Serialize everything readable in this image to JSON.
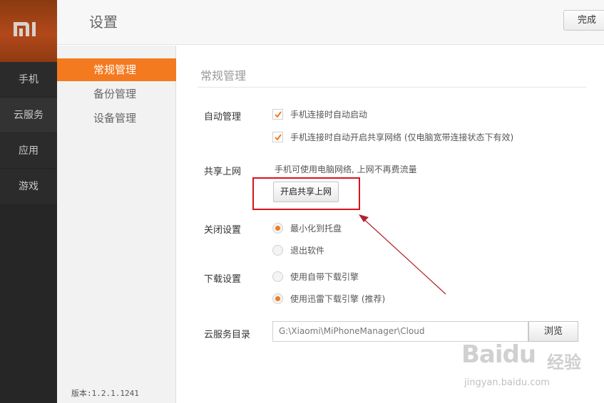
{
  "app": {
    "logo_text": "MI"
  },
  "left_nav": {
    "items": [
      "手机",
      "云服务",
      "应用",
      "游戏"
    ]
  },
  "header": {
    "title": "设置",
    "done_label": "完成"
  },
  "subnav": {
    "items": [
      "常规管理",
      "备份管理",
      "设备管理"
    ],
    "version": "版本:1.2.1.1241"
  },
  "content": {
    "section_title": "常规管理",
    "auto": {
      "label": "自动管理",
      "options": [
        "手机连接时自动启动",
        "手机连接时自动开启共享网络 (仅电脑宽带连接状态下有效)"
      ]
    },
    "share": {
      "label": "共享上网",
      "desc": "手机可使用电脑网络, 上网不再费流量",
      "button": "开启共享上网"
    },
    "close": {
      "label": "关闭设置",
      "options": [
        "最小化到托盘",
        "退出软件"
      ],
      "selected": 0
    },
    "download": {
      "label": "下载设置",
      "options": [
        "使用自带下载引擎",
        "使用迅雷下载引擎 (推荐)"
      ],
      "selected": 1
    },
    "cloud": {
      "label": "云服务目录",
      "path": "G:\\Xiaomi\\MiPhoneManager\\Cloud",
      "browse": "浏览"
    }
  },
  "watermark": {
    "logo": "Baidu",
    "cn": "经验",
    "url": "jingyan.baidu.com"
  },
  "colors": {
    "accent": "#f47a20",
    "highlight": "#d8141a",
    "sidebar": "#2b2b2b"
  }
}
